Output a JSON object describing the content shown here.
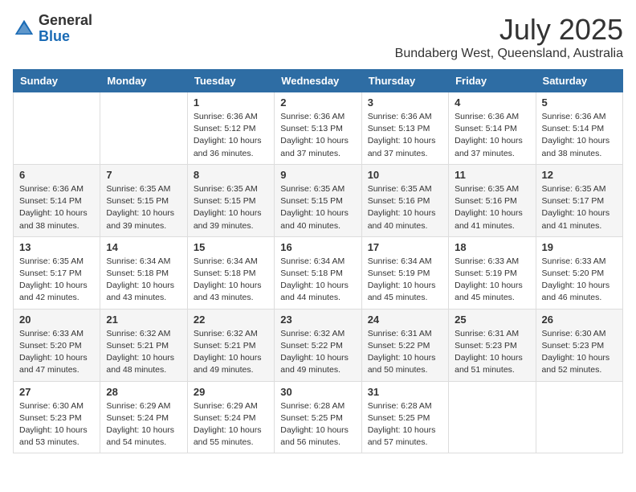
{
  "header": {
    "logo_general": "General",
    "logo_blue": "Blue",
    "month_year": "July 2025",
    "location": "Bundaberg West, Queensland, Australia"
  },
  "weekdays": [
    "Sunday",
    "Monday",
    "Tuesday",
    "Wednesday",
    "Thursday",
    "Friday",
    "Saturday"
  ],
  "weeks": [
    [
      {
        "day": "",
        "info": ""
      },
      {
        "day": "",
        "info": ""
      },
      {
        "day": "1",
        "info": "Sunrise: 6:36 AM\nSunset: 5:12 PM\nDaylight: 10 hours and 36 minutes."
      },
      {
        "day": "2",
        "info": "Sunrise: 6:36 AM\nSunset: 5:13 PM\nDaylight: 10 hours and 37 minutes."
      },
      {
        "day": "3",
        "info": "Sunrise: 6:36 AM\nSunset: 5:13 PM\nDaylight: 10 hours and 37 minutes."
      },
      {
        "day": "4",
        "info": "Sunrise: 6:36 AM\nSunset: 5:14 PM\nDaylight: 10 hours and 37 minutes."
      },
      {
        "day": "5",
        "info": "Sunrise: 6:36 AM\nSunset: 5:14 PM\nDaylight: 10 hours and 38 minutes."
      }
    ],
    [
      {
        "day": "6",
        "info": "Sunrise: 6:36 AM\nSunset: 5:14 PM\nDaylight: 10 hours and 38 minutes."
      },
      {
        "day": "7",
        "info": "Sunrise: 6:35 AM\nSunset: 5:15 PM\nDaylight: 10 hours and 39 minutes."
      },
      {
        "day": "8",
        "info": "Sunrise: 6:35 AM\nSunset: 5:15 PM\nDaylight: 10 hours and 39 minutes."
      },
      {
        "day": "9",
        "info": "Sunrise: 6:35 AM\nSunset: 5:15 PM\nDaylight: 10 hours and 40 minutes."
      },
      {
        "day": "10",
        "info": "Sunrise: 6:35 AM\nSunset: 5:16 PM\nDaylight: 10 hours and 40 minutes."
      },
      {
        "day": "11",
        "info": "Sunrise: 6:35 AM\nSunset: 5:16 PM\nDaylight: 10 hours and 41 minutes."
      },
      {
        "day": "12",
        "info": "Sunrise: 6:35 AM\nSunset: 5:17 PM\nDaylight: 10 hours and 41 minutes."
      }
    ],
    [
      {
        "day": "13",
        "info": "Sunrise: 6:35 AM\nSunset: 5:17 PM\nDaylight: 10 hours and 42 minutes."
      },
      {
        "day": "14",
        "info": "Sunrise: 6:34 AM\nSunset: 5:18 PM\nDaylight: 10 hours and 43 minutes."
      },
      {
        "day": "15",
        "info": "Sunrise: 6:34 AM\nSunset: 5:18 PM\nDaylight: 10 hours and 43 minutes."
      },
      {
        "day": "16",
        "info": "Sunrise: 6:34 AM\nSunset: 5:18 PM\nDaylight: 10 hours and 44 minutes."
      },
      {
        "day": "17",
        "info": "Sunrise: 6:34 AM\nSunset: 5:19 PM\nDaylight: 10 hours and 45 minutes."
      },
      {
        "day": "18",
        "info": "Sunrise: 6:33 AM\nSunset: 5:19 PM\nDaylight: 10 hours and 45 minutes."
      },
      {
        "day": "19",
        "info": "Sunrise: 6:33 AM\nSunset: 5:20 PM\nDaylight: 10 hours and 46 minutes."
      }
    ],
    [
      {
        "day": "20",
        "info": "Sunrise: 6:33 AM\nSunset: 5:20 PM\nDaylight: 10 hours and 47 minutes."
      },
      {
        "day": "21",
        "info": "Sunrise: 6:32 AM\nSunset: 5:21 PM\nDaylight: 10 hours and 48 minutes."
      },
      {
        "day": "22",
        "info": "Sunrise: 6:32 AM\nSunset: 5:21 PM\nDaylight: 10 hours and 49 minutes."
      },
      {
        "day": "23",
        "info": "Sunrise: 6:32 AM\nSunset: 5:22 PM\nDaylight: 10 hours and 49 minutes."
      },
      {
        "day": "24",
        "info": "Sunrise: 6:31 AM\nSunset: 5:22 PM\nDaylight: 10 hours and 50 minutes."
      },
      {
        "day": "25",
        "info": "Sunrise: 6:31 AM\nSunset: 5:23 PM\nDaylight: 10 hours and 51 minutes."
      },
      {
        "day": "26",
        "info": "Sunrise: 6:30 AM\nSunset: 5:23 PM\nDaylight: 10 hours and 52 minutes."
      }
    ],
    [
      {
        "day": "27",
        "info": "Sunrise: 6:30 AM\nSunset: 5:23 PM\nDaylight: 10 hours and 53 minutes."
      },
      {
        "day": "28",
        "info": "Sunrise: 6:29 AM\nSunset: 5:24 PM\nDaylight: 10 hours and 54 minutes."
      },
      {
        "day": "29",
        "info": "Sunrise: 6:29 AM\nSunset: 5:24 PM\nDaylight: 10 hours and 55 minutes."
      },
      {
        "day": "30",
        "info": "Sunrise: 6:28 AM\nSunset: 5:25 PM\nDaylight: 10 hours and 56 minutes."
      },
      {
        "day": "31",
        "info": "Sunrise: 6:28 AM\nSunset: 5:25 PM\nDaylight: 10 hours and 57 minutes."
      },
      {
        "day": "",
        "info": ""
      },
      {
        "day": "",
        "info": ""
      }
    ]
  ]
}
